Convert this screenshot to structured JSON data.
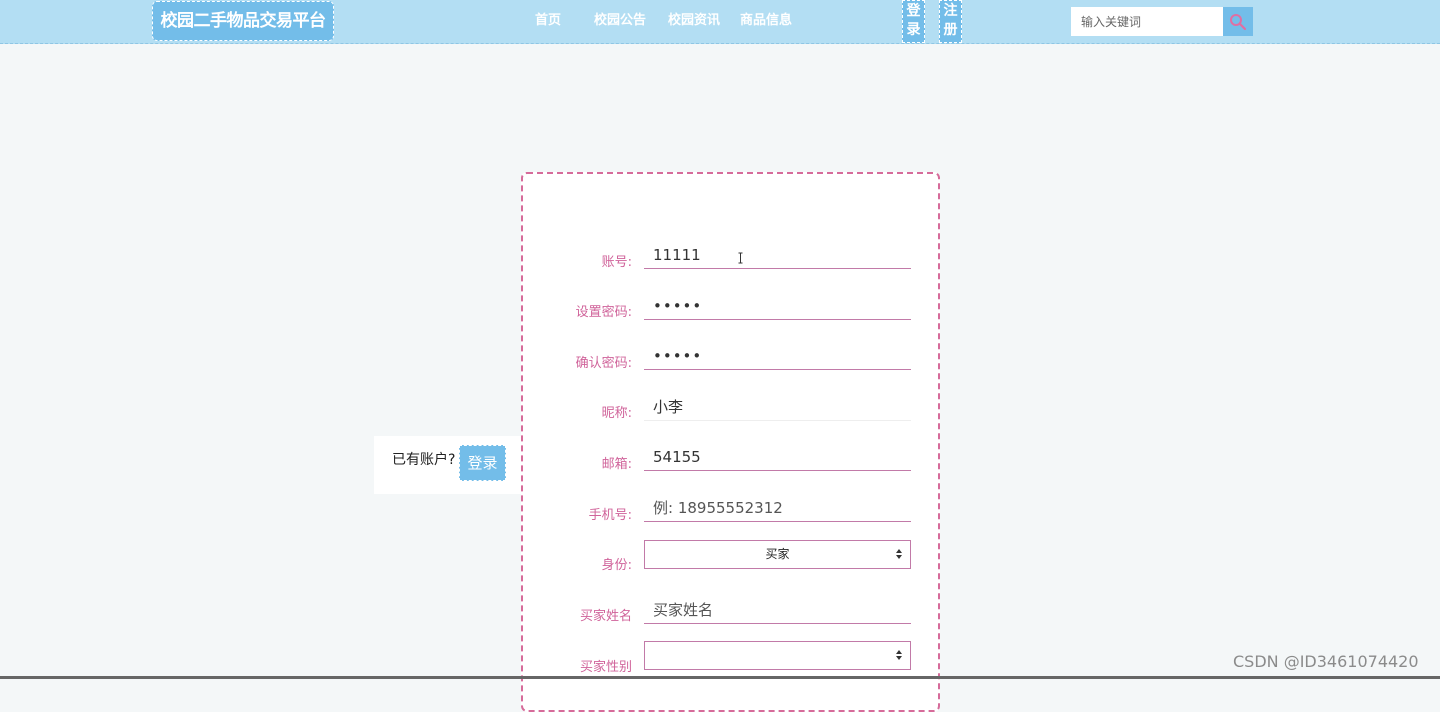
{
  "header": {
    "logo": "校园二手物品交易平台",
    "nav": [
      "首页",
      "校园公告",
      "校园资讯",
      "商品信息"
    ],
    "login_label": "登录",
    "register_label": "注册",
    "search_placeholder": "输入关键词"
  },
  "side": {
    "prompt": "已有账户?",
    "login_button": "登录"
  },
  "form": {
    "account_label": "账号:",
    "account_value": "11111",
    "password_label": "设置密码:",
    "password_value": "11111",
    "confirm_label": "确认密码:",
    "confirm_value": "11111",
    "nickname_label": "昵称:",
    "nickname_value": "小李",
    "email_label": "邮箱:",
    "email_value": "54155",
    "phone_label": "手机号:",
    "phone_placeholder": "例: 18955552312",
    "role_label": "身份:",
    "role_value": "买家",
    "buyer_name_label": "买家姓名",
    "buyer_name_placeholder": "买家姓名",
    "buyer_gender_label": "买家性别",
    "buyer_gender_value": ""
  },
  "watermark": "CSDN @ID3461074420",
  "colors": {
    "header_bg": "#b3def3",
    "accent_blue": "#73bde9",
    "label_pink": "#d0639a",
    "card_border": "#d66b9a"
  }
}
